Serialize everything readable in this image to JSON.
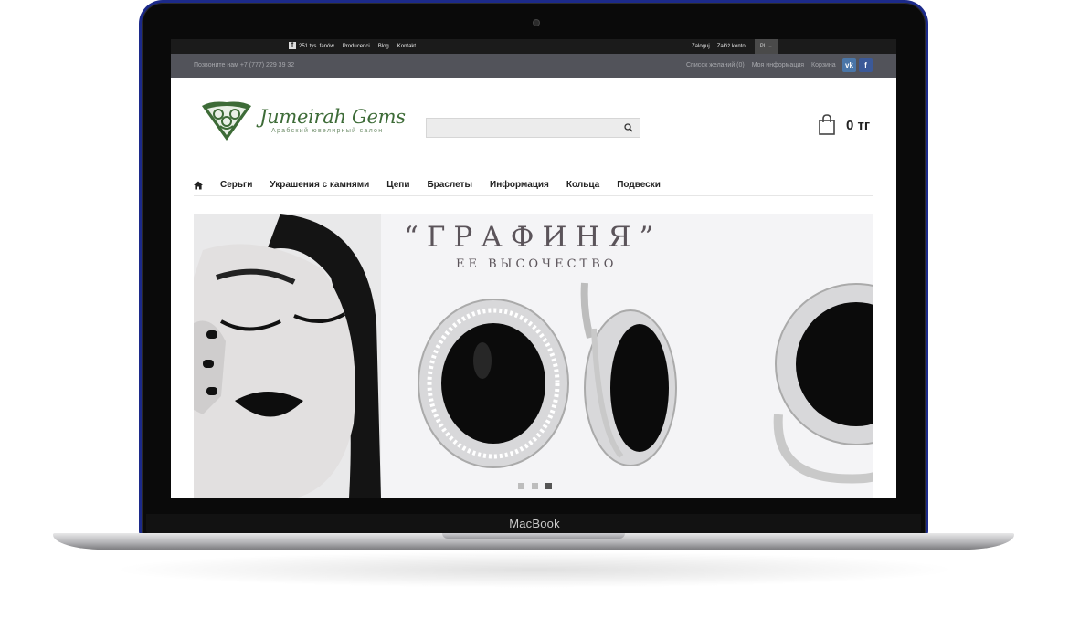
{
  "device": {
    "brand": "MacBook"
  },
  "topbar": {
    "fans": "251 tys. fanów",
    "links": [
      "Producenci",
      "Blog",
      "Kontakt"
    ],
    "login": "Zaloguj",
    "register": "Załóż konto",
    "lang": "PL"
  },
  "infobar": {
    "phone": "Позвоните нам +7 (777) 229 39 32",
    "links": [
      "Список желаний (0)",
      "Моя информация",
      "Корзина"
    ],
    "vk": "vk",
    "fb": "f"
  },
  "logo": {
    "title": "Jumeirah Gems",
    "subtitle": "Арабский ювелирный салон"
  },
  "search": {
    "placeholder": ""
  },
  "cart": {
    "total": "0 тг"
  },
  "nav": {
    "items": [
      "Серьги",
      "Украшения с камнями",
      "Цепи",
      "Браслеты",
      "Информация",
      "Кольца",
      "Подвески"
    ]
  },
  "banner": {
    "headline": "“ГРАФИНЯ”",
    "subline": "ЕЕ ВЫСОЧЕСТВО",
    "slides": 3,
    "active_slide": 3
  },
  "colors": {
    "brand_green": "#3d6b37",
    "topbar": "#1b1b1b",
    "infobar": "#52535a",
    "vk": "#4a76a8",
    "facebook": "#3b5998"
  }
}
